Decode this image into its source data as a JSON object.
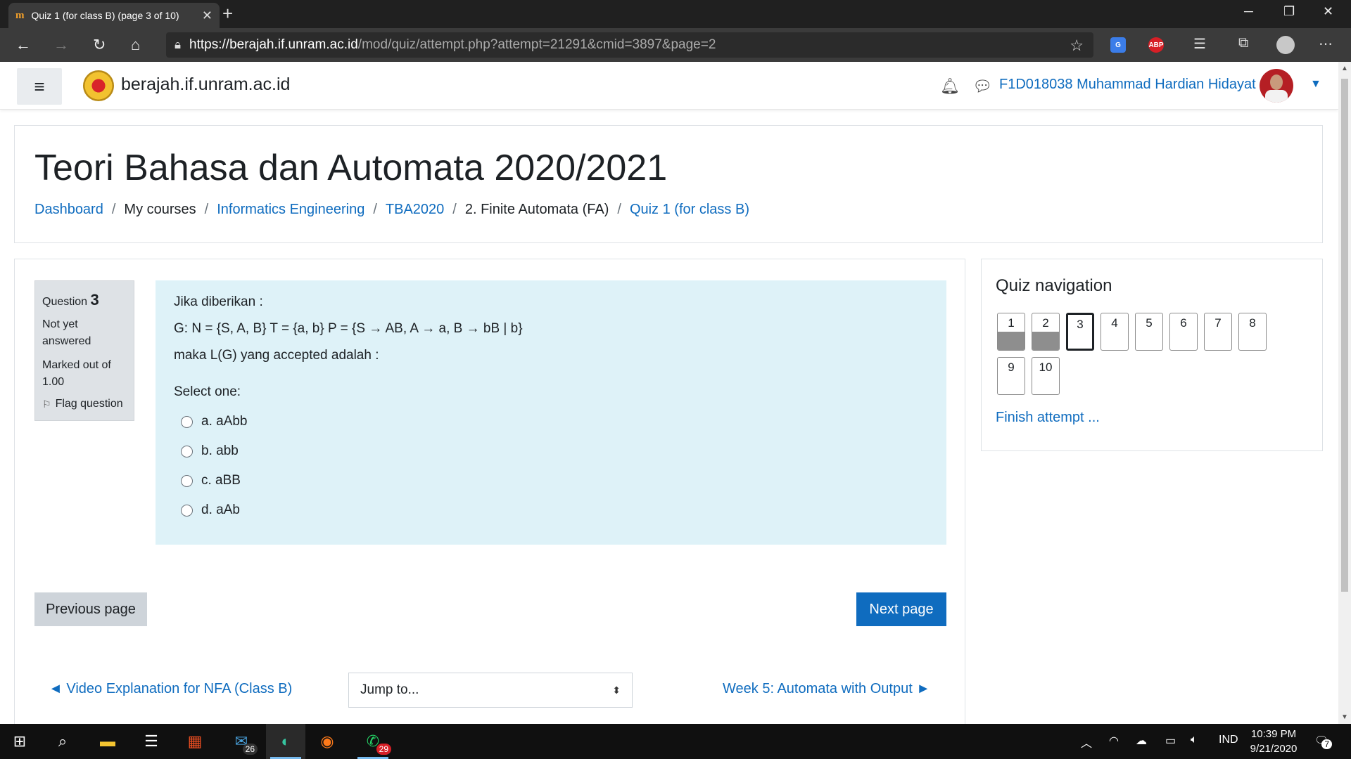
{
  "browser": {
    "tab_title": "Quiz 1 (for class B) (page 3 of 10)",
    "tab_favicon": "m",
    "url_scheme": "https://",
    "url_host": "berajah.if.unram.ac.id",
    "url_path": "/mod/quiz/attempt.php?attempt=21291&cmid=3897&page=2",
    "ext_translate": "G",
    "ext_abp": "ABP"
  },
  "navbar": {
    "site_name": "berajah.if.unram.ac.id",
    "username": "F1D018038 Muhammad Hardian Hidayat"
  },
  "header": {
    "course_title": "Teori Bahasa dan Automata 2020/2021",
    "breadcrumb": [
      "Dashboard",
      "My courses",
      "Informatics Engineering",
      "TBA2020",
      "2. Finite Automata (FA)",
      "Quiz 1 (for class B)"
    ]
  },
  "question": {
    "label": "Question",
    "number": "3",
    "state": "Not yet answered",
    "grade": "Marked out of 1.00",
    "flag": "Flag question",
    "text": [
      "Jika diberikan :",
      "G: N = {S, A, B} T = {a, b} P = {S → AB, A → a, B → bB | b}",
      "maka L(G) yang accepted adalah :"
    ],
    "prompt": "Select one:",
    "options": [
      "a. aAbb",
      "b. abb",
      "c. aBB",
      "d. aAb"
    ]
  },
  "buttons": {
    "previous": "Previous page",
    "next": "Next page"
  },
  "activity_nav": {
    "prev": "◄ Video Explanation for NFA (Class B)",
    "jump_placeholder": "Jump to...",
    "next": "Week 5: Automata with Output ►"
  },
  "quiz_nav": {
    "title": "Quiz navigation",
    "questions": [
      "1",
      "2",
      "3",
      "4",
      "5",
      "6",
      "7",
      "8",
      "9",
      "10"
    ],
    "answered": [
      1,
      2
    ],
    "current": 3,
    "finish": "Finish attempt ..."
  },
  "taskbar": {
    "mail_badge": "26",
    "whatsapp_badge": "29",
    "language": "IND",
    "time": "10:39 PM",
    "date": "9/21/2020",
    "notif_count": "7"
  },
  "colors": {
    "link": "#0f6cbf",
    "question_bg": "#def2f8",
    "info_bg": "#dee2e6",
    "answered_fill": "#8e8e8e"
  }
}
